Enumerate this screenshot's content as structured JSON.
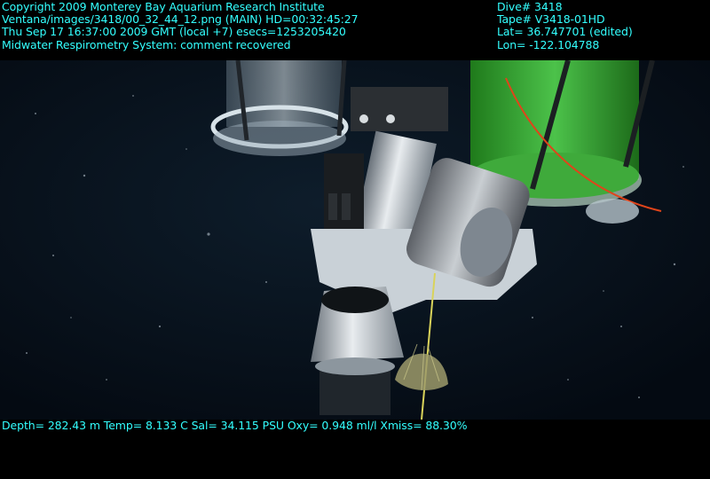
{
  "header": {
    "copyright": "Copyright 2009 Monterey Bay Aquarium Research Institute",
    "image_path": "Ventana/images/3418/00_32_44_12.png (MAIN)  HD=00:32:45:27",
    "timestamp": "Thu Sep 17 16:37:00 2009 GMT (local +7)  esecs=1253205420",
    "comment": "Midwater Respirometry System: comment recovered",
    "dive": "Dive# 3418",
    "tape": "Tape# V3418-01HD",
    "lat": "Lat= 36.747701 (edited)",
    "lon": "Lon= -122.104788"
  },
  "footer": {
    "sensors": "Depth= 282.43 m  Temp= 8.133 C  Sal= 34.115 PSU  Oxy= 0.948 ml/l  Xmiss= 88.30%"
  },
  "colors": {
    "overlay_text": "#33ffff",
    "water": "#081420",
    "green_chamber": "#2fa82a"
  }
}
